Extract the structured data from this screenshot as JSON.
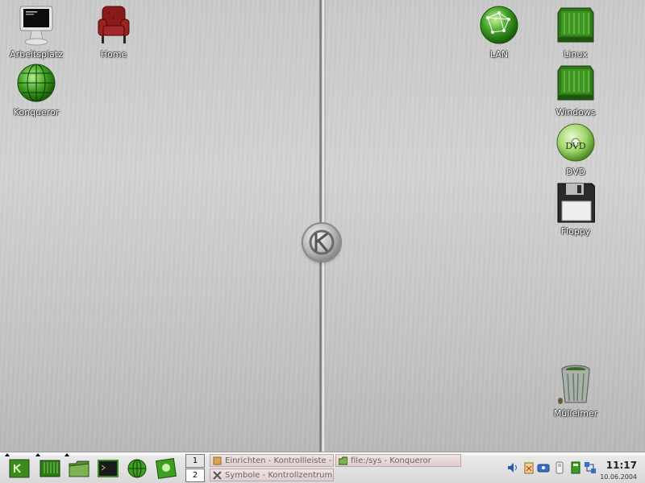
{
  "desktop": {
    "icons": [
      {
        "label": "Arbeitsplatz",
        "icon": "computer-monitor-icon"
      },
      {
        "label": "Home",
        "icon": "armchair-icon"
      },
      {
        "label": "Konqueror",
        "icon": "globe-icon"
      },
      {
        "label": "LAN",
        "icon": "network-globe-icon"
      },
      {
        "label": "Linux",
        "icon": "hard-drive-icon"
      },
      {
        "label": "Windows",
        "icon": "hard-drive-icon"
      },
      {
        "label": "DVD",
        "icon": "dvd-disc-icon",
        "disc_text": "DVD"
      },
      {
        "label": "Floppy",
        "icon": "floppy-disk-icon"
      },
      {
        "label": "Mülleimer",
        "icon": "trash-can-icon"
      }
    ],
    "center_logo": "kde-gear-logo"
  },
  "panel": {
    "launchers": [
      {
        "name": "kmenu-launcher",
        "icon": "kmenu-icon"
      },
      {
        "name": "drive-launcher",
        "icon": "drive-icon"
      },
      {
        "name": "folder-launcher",
        "icon": "folder-icon"
      },
      {
        "name": "terminal-launcher",
        "icon": "terminal-icon"
      },
      {
        "name": "browser-launcher",
        "icon": "globe-icon"
      },
      {
        "name": "image-launcher",
        "icon": "image-icon"
      }
    ],
    "pager": {
      "desktops": [
        "1",
        "2"
      ]
    },
    "tasks": [
      {
        "title": "Einrichten - Kontrollleiste - ",
        "icon": "settings-icon"
      },
      {
        "title": "file:/sys - Konqueror",
        "icon": "folder-icon"
      },
      {
        "title": "Symbole - Kontrollzentrum",
        "icon": "tools-icon"
      }
    ],
    "tray": [
      "speaker-icon",
      "clipboard-icon",
      "keyboard-icon",
      "usb-stick-icon",
      "calculator-icon",
      "network-icon"
    ],
    "clock": {
      "time": "11:17",
      "date": "10.06.2004"
    }
  },
  "colors": {
    "accent": "#3a8a1e",
    "wallpaper": "#c6c6c6",
    "task_bg": "#e8d7d7"
  }
}
